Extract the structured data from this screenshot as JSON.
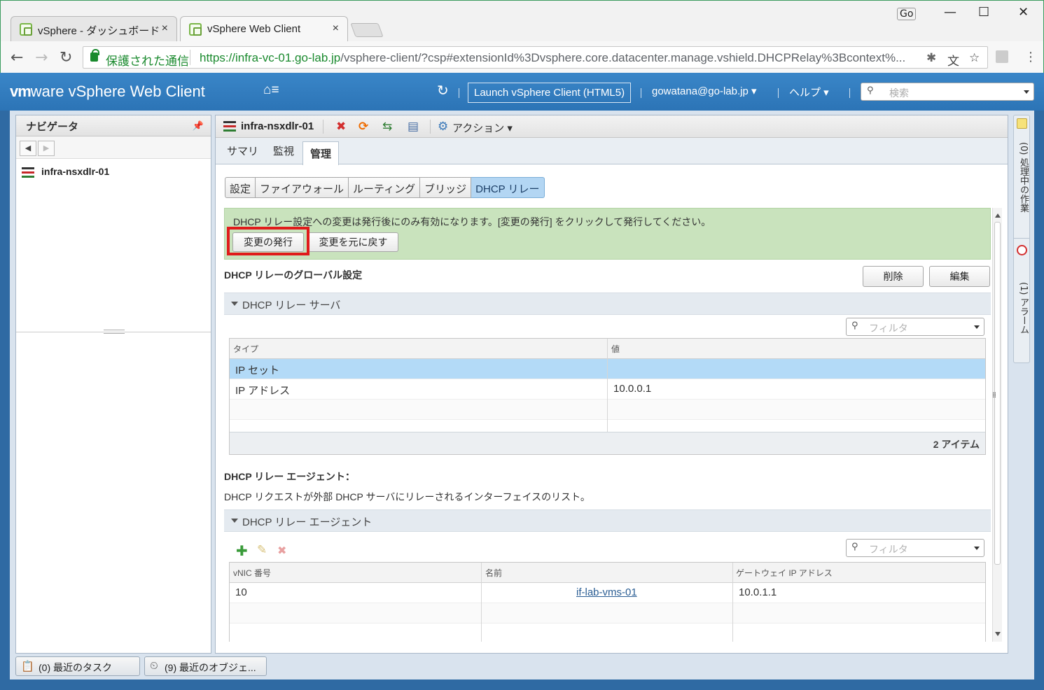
{
  "browser": {
    "tabs": [
      {
        "title": "vSphere - ダッシュボード",
        "close": "×"
      },
      {
        "title": "vSphere Web Client",
        "close": "×"
      }
    ],
    "profile_badge": "Go",
    "secure_label": "保護された通信",
    "url_host": "https://infra-vc-01.go-lab.jp",
    "url_path": "/vsphere-client/?csp#extensionId%3Dvsphere.core.datacenter.manage.vshield.DHCPRelay%3Bcontext%..."
  },
  "header": {
    "logo_vm": "vm",
    "logo_ware": "ware",
    "logo_product": " vSphere Web Client",
    "home_glyph": "⌂≡",
    "refresh_glyph": "↻",
    "launch_html5": "Launch vSphere Client (HTML5)",
    "user": "gowatana@go-lab.jp ▾",
    "help": "ヘルプ ▾",
    "search_placeholder": "検索"
  },
  "navigator": {
    "title": "ナビゲータ",
    "tree_item": "infra-nsxdlr-01"
  },
  "object": {
    "name": "infra-nsxdlr-01",
    "actions": "アクション ▾"
  },
  "main_tabs": {
    "summary": "サマリ",
    "monitor": "監視",
    "manage": "管理"
  },
  "sub_tabs": [
    "設定",
    "ファイアウォール",
    "ルーティング",
    "ブリッジ",
    "DHCP リレー"
  ],
  "notice": {
    "message": "DHCP リレー設定への変更は発行後にのみ有効になります。[変更の発行] をクリックして発行してください。",
    "publish": "変更の発行",
    "revert": "変更を元に戻す"
  },
  "global": {
    "title": "DHCP リレーのグローバル設定",
    "delete": "削除",
    "edit": "編集",
    "section": "DHCP リレー サーバ",
    "filter_placeholder": "フィルタ",
    "columns": [
      "タイプ",
      "値"
    ],
    "rows": [
      {
        "type": "IP セット",
        "value": ""
      },
      {
        "type": "IP アドレス",
        "value": "10.0.0.1"
      }
    ],
    "count": "2 アイテム"
  },
  "agents": {
    "title": "DHCP リレー エージェント：",
    "description": "DHCP リクエストが外部 DHCP サーバにリレーされるインターフェイスのリスト。",
    "section": "DHCP リレー エージェント",
    "filter_placeholder": "フィルタ",
    "columns": [
      "vNIC 番号",
      "名前",
      "ゲートウェイ IP アドレス"
    ],
    "rows": [
      {
        "vnic": "10",
        "name": "if-lab-vms-01",
        "gateway": "10.0.1.1"
      }
    ]
  },
  "right_panel": {
    "tasks": "(0) 処理中の作業",
    "alarms": "(1) アラーム"
  },
  "bottom": {
    "recent_tasks": "(0)  最近のタスク",
    "recent_objects": "(9) 最近のオブジェ..."
  }
}
